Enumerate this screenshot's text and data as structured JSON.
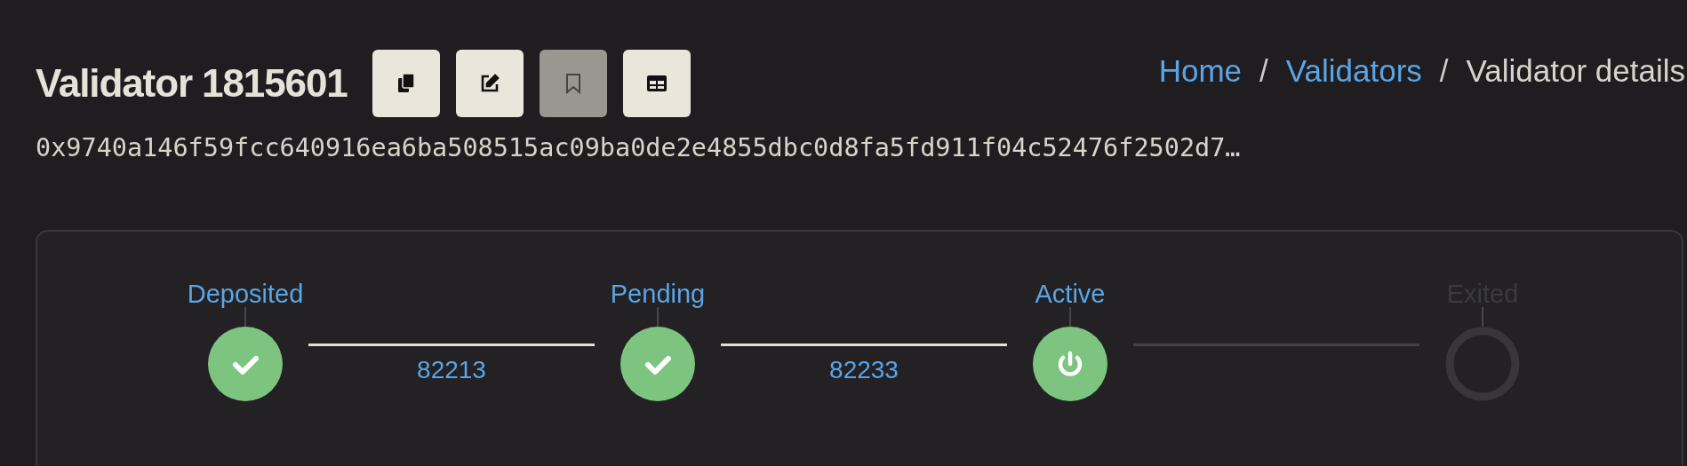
{
  "title": "Validator 1815601",
  "actions": [
    {
      "kind": "copy",
      "disabled": false
    },
    {
      "kind": "edit",
      "disabled": false
    },
    {
      "kind": "bookmark",
      "disabled": true
    },
    {
      "kind": "table",
      "disabled": false
    }
  ],
  "breadcrumb": [
    {
      "label": "Home",
      "link": true
    },
    {
      "separator": "/",
      "label": "Validators",
      "link": true
    },
    {
      "separator": "/",
      "label": "Validator details",
      "link": false
    }
  ],
  "pubkey": "0x9740a146f59fcc640916ea6ba508515ac09ba0de2e4855dbc0d8fa5fd911f04c52476f2502d7…",
  "steps": [
    {
      "label": "Deposited",
      "kind": "done"
    },
    {
      "label": "Pending",
      "kind": "done"
    },
    {
      "label": "Active",
      "kind": "active"
    },
    {
      "label": "Exited",
      "kind": "future"
    }
  ],
  "connectors": [
    {
      "label": "82213",
      "completed": true
    },
    {
      "label": "82233",
      "completed": true
    },
    {
      "completed": false
    }
  ]
}
